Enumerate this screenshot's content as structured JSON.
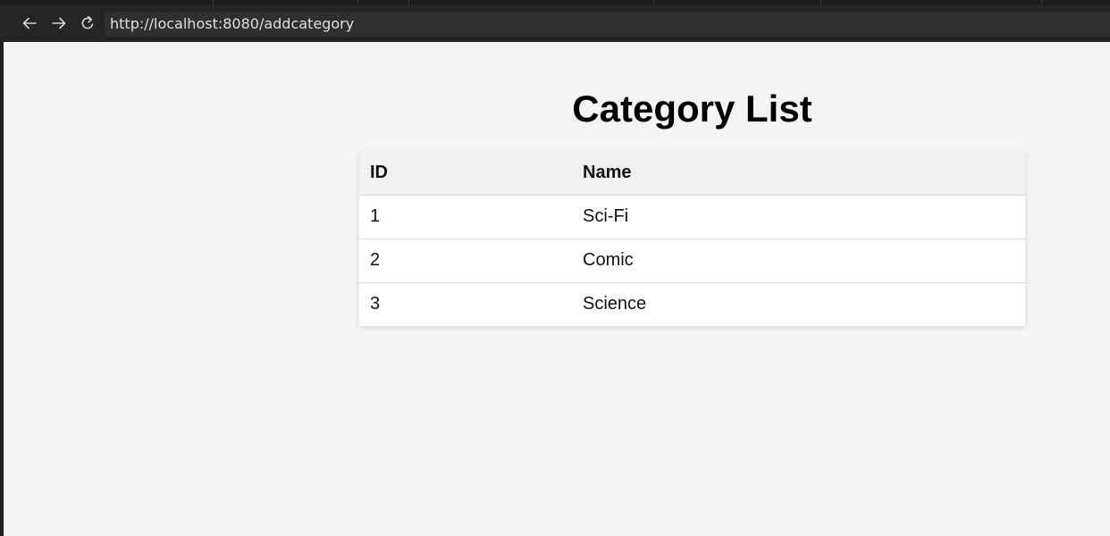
{
  "browser": {
    "url": "http://localhost:8080/addcategory",
    "back_icon": "arrow-left-icon",
    "forward_icon": "arrow-right-icon",
    "reload_icon": "reload-icon"
  },
  "page": {
    "title": "Category List",
    "table": {
      "headers": [
        "ID",
        "Name"
      ],
      "rows": [
        {
          "id": "1",
          "name": "Sci-Fi"
        },
        {
          "id": "2",
          "name": "Comic"
        },
        {
          "id": "3",
          "name": "Science"
        }
      ]
    }
  }
}
